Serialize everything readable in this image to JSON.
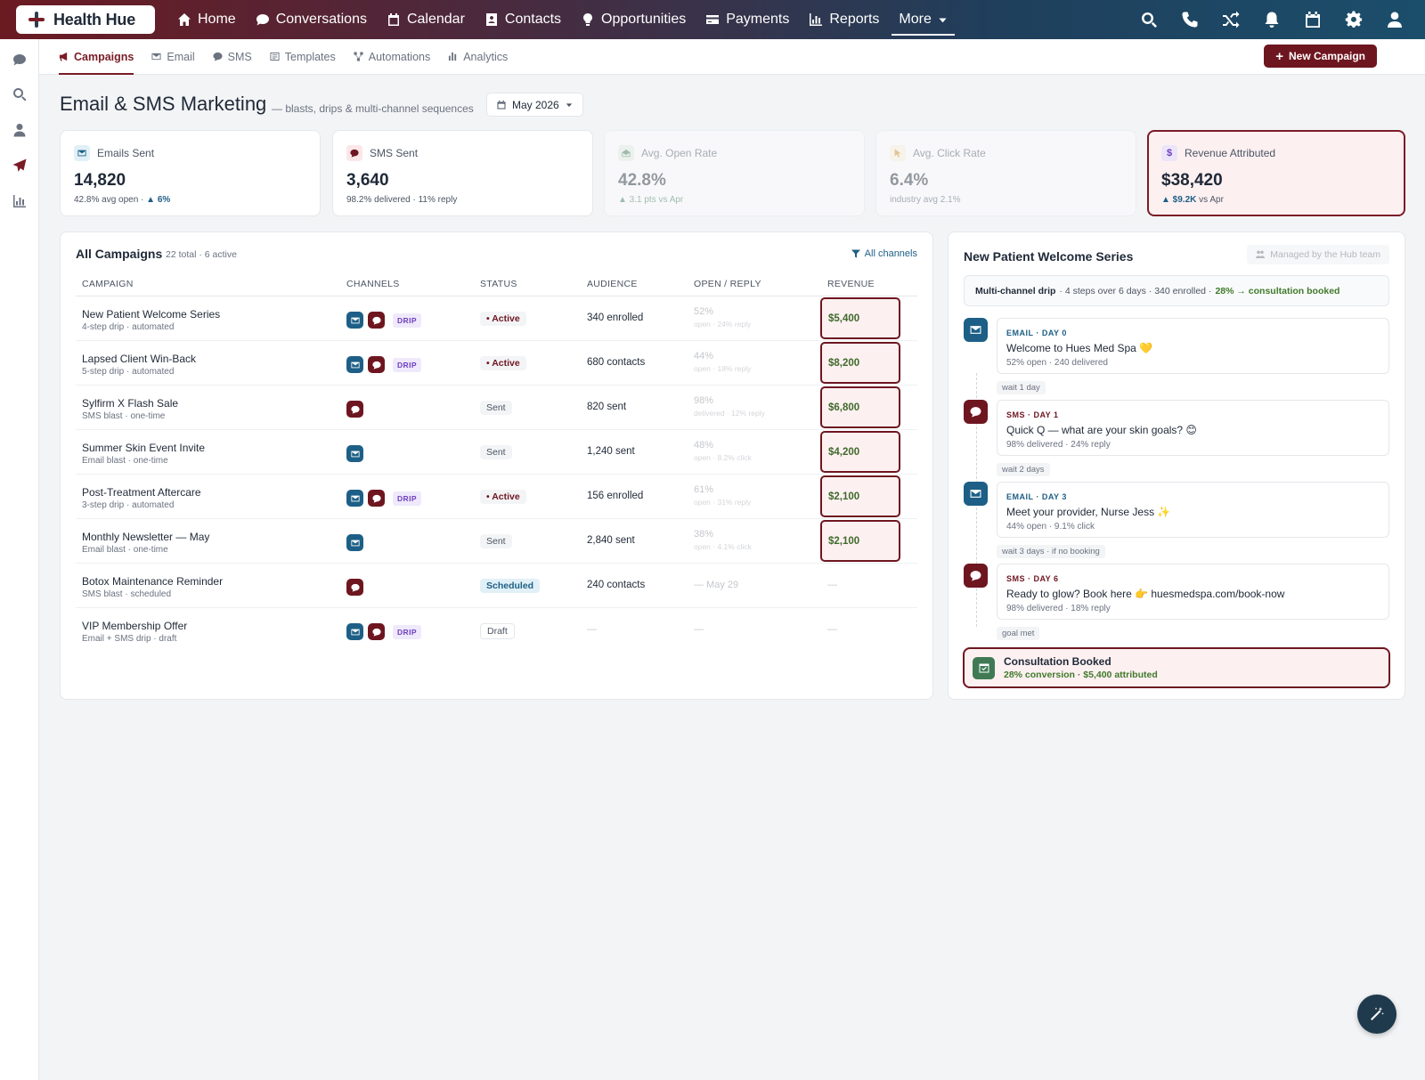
{
  "brand": {
    "name": "Health Hue"
  },
  "nav": {
    "items": [
      {
        "label": "Home",
        "icon": "home-icon"
      },
      {
        "label": "Conversations",
        "icon": "chat-icon"
      },
      {
        "label": "Calendar",
        "icon": "calendar-icon"
      },
      {
        "label": "Contacts",
        "icon": "contact-card-icon"
      },
      {
        "label": "Opportunities",
        "icon": "lightbulb-icon"
      },
      {
        "label": "Payments",
        "icon": "credit-card-icon"
      },
      {
        "label": "Reports",
        "icon": "bar-chart-icon"
      },
      {
        "label": "More",
        "icon": "caret-down-icon"
      }
    ]
  },
  "subnav": {
    "tabs": [
      "Campaigns",
      "Email",
      "SMS",
      "Templates",
      "Automations",
      "Analytics"
    ],
    "new_campaign": "New Campaign"
  },
  "header": {
    "title": "Email & SMS Marketing",
    "subtitle": "— blasts, drips & multi-channel sequences",
    "month": "May 2026"
  },
  "stats": [
    {
      "label": "Emails Sent",
      "value": "14,820",
      "foot": "42.8% avg open · ",
      "delta": "▲ 6%"
    },
    {
      "label": "SMS Sent",
      "value": "3,640",
      "foot": "98.2% delivered · 11% reply",
      "delta": ""
    },
    {
      "label": "Avg. Open Rate",
      "value": "42.8%",
      "foot": "",
      "delta": "▲ 3.1 pts vs Apr"
    },
    {
      "label": "Avg. Click Rate",
      "value": "6.4%",
      "foot": "industry avg 2.1%",
      "delta": ""
    },
    {
      "label": "Revenue Attributed",
      "value": "$38,420",
      "foot": " vs Apr",
      "delta": "▲ $9.2K"
    }
  ],
  "campaigns": {
    "title": "All Campaigns",
    "sub": "22 total · 6 active",
    "filter": "All channels",
    "columns": [
      "CAMPAIGN",
      "CHANNELS",
      "STATUS",
      "AUDIENCE",
      "OPEN / REPLY",
      "REVENUE"
    ],
    "rows": [
      {
        "name": "New Patient Welcome Series",
        "sub": "4-step drip · automated",
        "status": "Active",
        "audience": "340 enrolled",
        "open": "52%",
        "open_sub": "open · 24% reply",
        "revenue": "$5,400"
      },
      {
        "name": "Lapsed Client Win-Back",
        "sub": "5-step drip · automated",
        "status": "Active",
        "audience": "680 contacts",
        "open": "44%",
        "open_sub": "open · 18% reply",
        "revenue": "$8,200"
      },
      {
        "name": "Sylfirm X Flash Sale",
        "sub": "SMS blast · one-time",
        "status": "Sent",
        "audience": "820 sent",
        "open": "98%",
        "open_sub": "delivered · 12% reply",
        "revenue": "$6,800"
      },
      {
        "name": "Summer Skin Event Invite",
        "sub": "Email blast · one-time",
        "status": "Sent",
        "audience": "1,240 sent",
        "open": "48%",
        "open_sub": "open · 8.2% click",
        "revenue": "$4,200"
      },
      {
        "name": "Post-Treatment Aftercare",
        "sub": "3-step drip · automated",
        "status": "Active",
        "audience": "156 enrolled",
        "open": "61%",
        "open_sub": "open · 31% reply",
        "revenue": "$2,100"
      },
      {
        "name": "Monthly Newsletter — May",
        "sub": "Email blast · one-time",
        "status": "Sent",
        "audience": "2,840 sent",
        "open": "38%",
        "open_sub": "open · 4.1% click",
        "revenue": "$2,100"
      },
      {
        "name": "Botox Maintenance Reminder",
        "sub": "SMS blast · scheduled",
        "status": "Scheduled",
        "audience": "240 contacts",
        "open": "— May 29",
        "open_sub": "",
        "revenue": "—"
      },
      {
        "name": "VIP Membership Offer",
        "sub": "Email + SMS drip · draft",
        "status": "Draft",
        "audience": "—",
        "open": "—",
        "open_sub": "",
        "revenue": "—"
      }
    ],
    "drip_label": "DRIP"
  },
  "drip": {
    "title": "New Patient Welcome Series",
    "managed": "Managed by the Hub team",
    "summary_bold": "Multi-channel drip",
    "summary_text": " · 4 steps over 6 days · 340 enrolled · ",
    "summary_goal": "28% → consultation booked",
    "steps": [
      {
        "label": "EMAIL · DAY 0",
        "msg": "Welcome to Hues Med Spa 💛",
        "meta": "52% open · 240 delivered"
      },
      {
        "label": "SMS · DAY 1",
        "msg": "Quick Q — what are your skin goals? 😊",
        "meta": "98% delivered · 24% reply"
      },
      {
        "label": "EMAIL · DAY 3",
        "msg": "Meet your provider, Nurse Jess ✨",
        "meta": "44% open · 9.1% click"
      },
      {
        "label": "SMS · DAY 6",
        "msg": "Ready to glow? Book here 👉 huesmedspa.com/book-now",
        "meta": "98% delivered · 18% reply"
      }
    ],
    "waits": [
      "wait 1 day",
      "wait 2 days",
      "wait 3 days · if no booking",
      "goal met"
    ],
    "goal_title": "Consultation Booked",
    "goal_sub": "28% conversion · $5,400 attributed"
  },
  "colors": {
    "brand": "#6e1620",
    "email": "#1d5f86",
    "positive": "#3f7a2b"
  }
}
